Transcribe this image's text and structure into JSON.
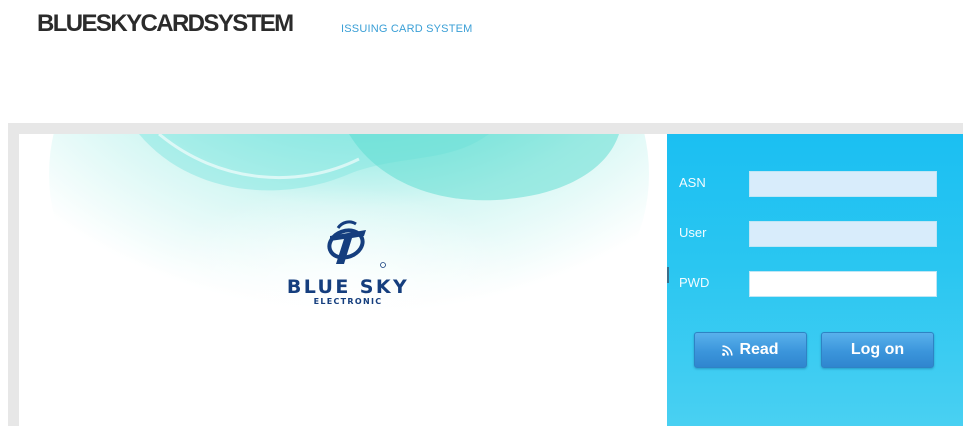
{
  "header": {
    "title": "BLUESKYCARDSYSTEM",
    "subtitle": "ISSUING CARD SYSTEM"
  },
  "banner": {
    "brand_name": "BLUE SKY",
    "brand_sub": "ELECTRONIC",
    "colors": {
      "accent": "#2fd6cf",
      "brand": "#153e7e"
    }
  },
  "login": {
    "asn_label": "ASN",
    "asn_value": "",
    "user_label": "User",
    "user_value": "",
    "pwd_label": "PWD",
    "pwd_value": "",
    "read_label": "Read",
    "read_icon": "rss-icon",
    "logon_label": "Log on",
    "colors": {
      "panel": "#1bbff2",
      "button": "#3b95db"
    }
  }
}
